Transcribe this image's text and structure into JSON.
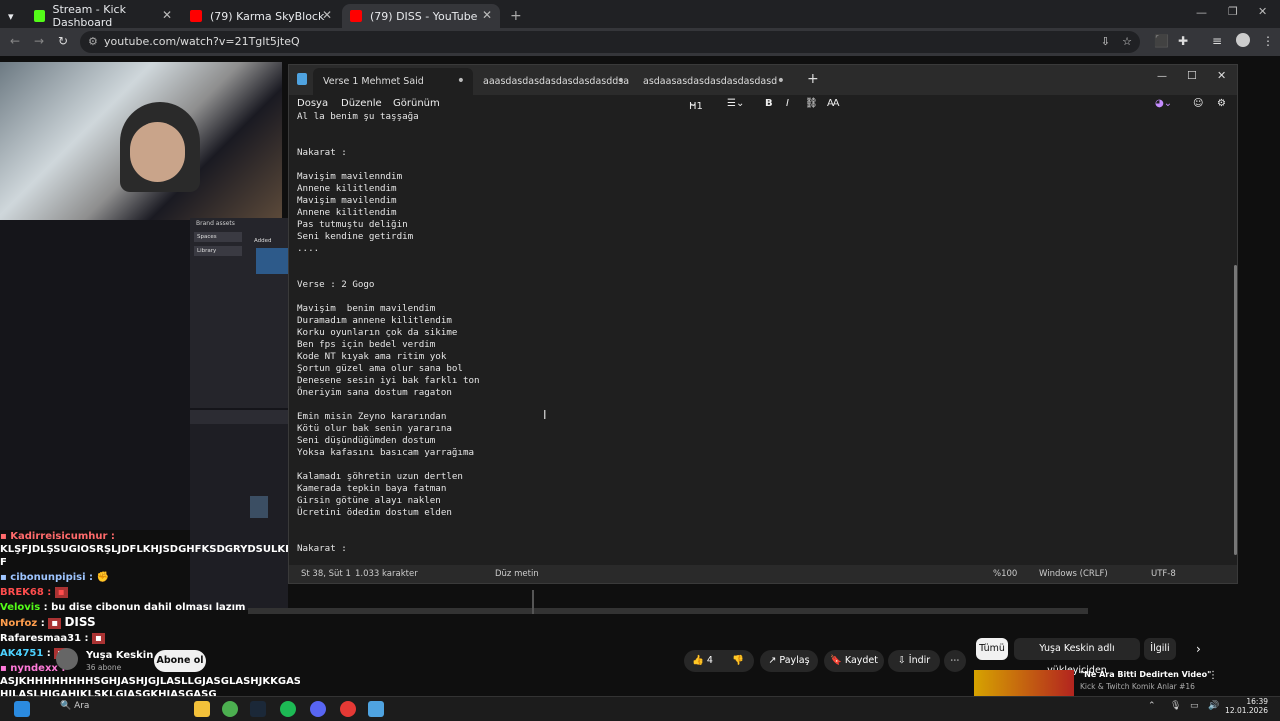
{
  "browser": {
    "tabs": [
      {
        "title": "Stream - Kick Dashboard",
        "color": "#53fc18"
      },
      {
        "title": "(79) Karma SkyBlock Açıldı Fecii",
        "color": "#ff0000"
      },
      {
        "title": "(79) DISS - YouTube",
        "color": "#ff0000"
      }
    ],
    "url": "youtube.com/watch?v=21TgIt5jteQ"
  },
  "notepad": {
    "tabs": [
      "Verse 1  Mehmet Said",
      "aaasdasdasdasdasdasdasddsa",
      "asdaasasdasdasdasdasdasd"
    ],
    "menu": [
      "Dosya",
      "Düzenle",
      "Görünüm"
    ],
    "heading_select": "H1",
    "text": "Al la benim şu taşşağa\n\n\nNakarat :\n\nMavişim mavilenndim\nAnnene kilitlendim\nMavişim mavilendim\nAnnene kilitlendim\nPas tutmuştu deliğin\nSeni kendine getirdim\n....\n\n\nVerse : 2 Gogo\n\nMavişim  benim mavilendim\nDuramadım annene kilitlendim\nKorku oyunların çok da sikime\nBen fps için bedel verdim\nKode NT kıyak ama ritim yok\nŞortun güzel ama olur sana bol\nDenesene sesin iyi bak farklı ton\nÖneriyim sana dostum ragaton\n\nEmin misin Zeyno kararından\nKötü olur bak senin yararına\nSeni düşündüğümden dostum\nYoksa kafasını basıcam yarrağıma\n\nKalamadı şöhretin uzun dertlen\nKamerada tepkin baya fatman\nGirsin götüne alayı naklen\nÜcretini ödedim dostum elden\n\n\nNakarat :",
    "status": {
      "position": "St 38, Süt 1",
      "chars": "1.033 karakter",
      "mode": "Düz metin",
      "zoom": "%100",
      "eol": "Windows (CRLF)",
      "encoding": "UTF-8"
    }
  },
  "chat": [
    {
      "user": "Kadirreisicumhur",
      "color": "#ff6b6b",
      "msg": ""
    },
    {
      "user": "",
      "color": "#fff",
      "msg": "KLŞFJDLŞSUGIOSRŞLJDFLKHJSDGHFKSDGRYDSULKFGYDSHKGS"
    },
    {
      "user": "",
      "color": "#fff",
      "msg": "F"
    },
    {
      "user": "cibonunpipisi",
      "color": "#9ec5ff",
      "msg": ""
    },
    {
      "user": "BREK68",
      "color": "#ff4d4d",
      "msg": ""
    },
    {
      "user": "Velovis",
      "color": "#53fc18",
      "msg": "bu dise cibonun dahil olması lazım"
    },
    {
      "user": "Norfoz",
      "color": "#ff9e4d",
      "msg": "DISS"
    },
    {
      "user": "Rafaresmaa31",
      "color": "#ffffff",
      "msg": ""
    },
    {
      "user": "AK4751",
      "color": "#4dd2ff",
      "msg": ""
    },
    {
      "user": "nyndexx",
      "color": "#ff7ad9",
      "msg": ""
    },
    {
      "user": "",
      "color": "#fff",
      "msg": "ASJKHHHHHHHHSGHJASHJGJLASLLGJASGLASHJKKGASJKHGK"
    },
    {
      "user": "",
      "color": "#fff",
      "msg": "HJLASLHJGAHJKLSKLGJASGKHJASGASG"
    }
  ],
  "channel": {
    "name": "Yuşa Keskin",
    "subs": "36 abone",
    "subscribe": "Abone ol"
  },
  "actions": {
    "likes": "4",
    "share": "Paylaş",
    "save": "Kaydet",
    "download": "İndir"
  },
  "related": {
    "chips": [
      "Tümü",
      "Yuşa Keskin adlı yükleyiciden",
      "İlgili"
    ],
    "video_title": "\"Ne Ara Bitti Dedirten Video\"",
    "video_sub": "Kick & Twitch Komik Anlar #16"
  },
  "taskbar": {
    "time": "16:39",
    "date": "12.01.2026",
    "search": "Ara"
  },
  "editor_panel": {
    "brand": "Brand assets",
    "spaces": "Spaces",
    "library": "Library",
    "added": "Added"
  }
}
